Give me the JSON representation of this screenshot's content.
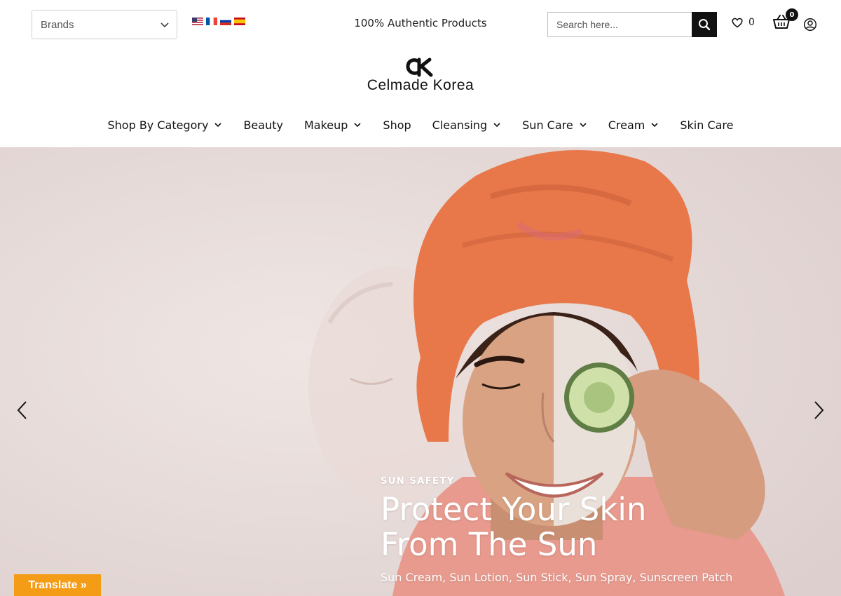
{
  "topbar": {
    "brands_select": {
      "value": "Brands"
    },
    "flags": [
      "english-flag",
      "french-flag",
      "russian-flag",
      "spanish-flag"
    ],
    "tagline": "100% Authentic Products",
    "search": {
      "placeholder": "Search here..."
    },
    "wishlist_count": "0",
    "cart_count": "0"
  },
  "logo": {
    "text": "Celmade Korea"
  },
  "nav": {
    "items": [
      {
        "label": "Shop By Category",
        "dropdown": true
      },
      {
        "label": "Beauty",
        "dropdown": false
      },
      {
        "label": "Makeup",
        "dropdown": true
      },
      {
        "label": "Shop",
        "dropdown": false
      },
      {
        "label": "Cleansing",
        "dropdown": true
      },
      {
        "label": "Sun Care",
        "dropdown": true
      },
      {
        "label": "Cream",
        "dropdown": true
      },
      {
        "label": "Skin Care",
        "dropdown": false
      }
    ]
  },
  "hero": {
    "eyebrow": "SUN SAFETY",
    "headline_line1": "Protect Your Skin",
    "headline_line2": "From The Sun",
    "subline": "Sun Cream, Sun Lotion, Sun Stick, Sun Spray, Sunscreen Patch"
  },
  "translate_button": "Translate »",
  "colors": {
    "accent_translate": "#f59c16",
    "towel": "#e8774a",
    "hero_background": "#e8dedd"
  }
}
